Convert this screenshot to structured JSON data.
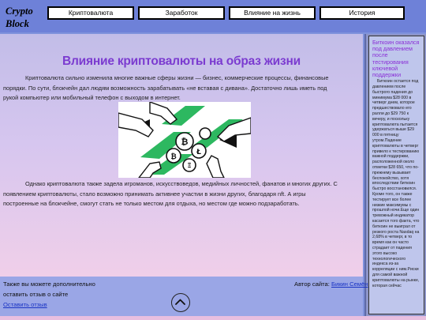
{
  "header": {
    "logo_line1": "Crypto",
    "logo_line2": "Block",
    "nav": [
      "Криптовалюта",
      "Заработок",
      "Влияние на жизнь",
      "История"
    ]
  },
  "article": {
    "title": "Влияние криптовалюты на образ жизни",
    "paragraph1": "Криптовалюта сильно изменила многие важные сферы жизни — бизнес, коммерческие процессы, финансовые порядки. По сути, блокчейн дал людям возможность зарабатывать «не вставая с дивана». Достаточно лишь иметь под рукой компьютер или мобильный телефон с выходом в интернет.",
    "paragraph2": "Однако криптовалюта также задела игроманов, искусствоведов, медийных личностей, фанатов и многих других. С появлением криптовалюты, стало возможно принимать активнее участии в жизни других, благодаря nft. А игры построенные на блокчейне, смогут стать не только местом для отдыха, но местом где можно подзаработать."
  },
  "sidebar": {
    "title": "Биткоин оказался под давлением после тестирования ключевой поддержки",
    "text": "Биткоин остается под давлением после быстрого падения до минимума $28 000 в четверг днем, которое предшествовало его ралли до $29 750 к вечеру, и поскольку криптовалюта пытается удержаться выше $29 000 в пятницу утром.Падение криптовалюты в четверг привело к тестированию важной поддержки, расположенной около отметки $28 650, что по-прежнему вызывает беспокойство, хотя впоследствии биткоин быстро восстановился. Кроме того, он также тестирует все более низкие максимумы с прошлой ночи.Еще один тревожный индикатор касается того факта, что биткоин не выиграл от резкого роста Nasdaq на 2,68% в четверг, в то время как он часто страдает от падения этого высоко технологического индекса из-за корреляции с ним.Риски для самой важной криптовалюты на рынке, которая сейчас"
  },
  "footer": {
    "feedback_line1": "Также вы можете дополнительно",
    "feedback_line2": "оставить отзыв о сайте",
    "feedback_link": "Оставить отзыв",
    "author_label": "Автор сайта:",
    "author_name": "Бикин Семён"
  },
  "colors": {
    "title": "#7b3bd0",
    "link": "#1a34c4",
    "sidebar_title": "#8a2fd6"
  },
  "icons": {
    "scroll_top": "chevron-up-icon",
    "illustration": "crypto-hands-illustration"
  }
}
